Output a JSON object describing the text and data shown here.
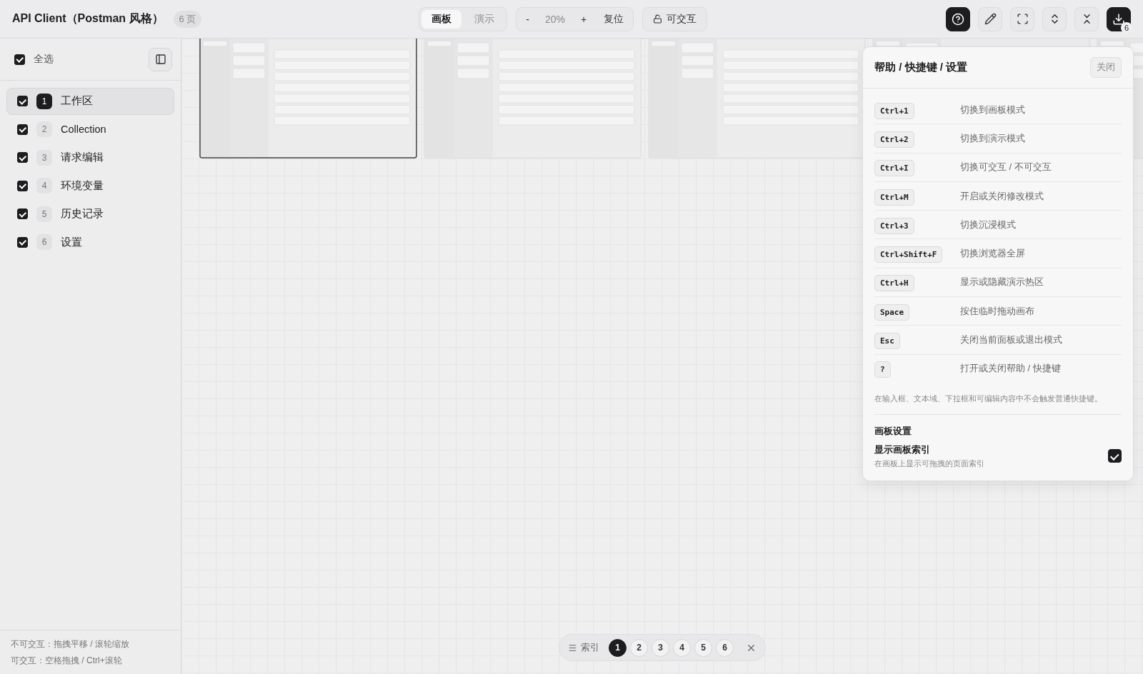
{
  "app": {
    "title": "API Client（Postman 风格）",
    "page_count": "6 页"
  },
  "mode_tabs": [
    {
      "label": "画板",
      "selected": true
    },
    {
      "label": "演示",
      "selected": false
    }
  ],
  "zoom": {
    "minus": "-",
    "value": "20%",
    "plus": "+",
    "reset": "复位"
  },
  "interact_button": {
    "label": "可交互",
    "locked": false
  },
  "toolbar": [
    {
      "kind": "help",
      "selected": true
    },
    {
      "kind": "edit",
      "selected": false
    },
    {
      "kind": "fullscreen",
      "selected": false
    },
    {
      "kind": "expand",
      "selected": false
    },
    {
      "kind": "collapse",
      "selected": false
    },
    {
      "kind": "download",
      "selected": true,
      "badge": "6"
    }
  ],
  "sidebar": {
    "select_all": {
      "label": "全选",
      "checked": true
    },
    "pages": [
      {
        "number": "1",
        "label": "工作区",
        "checked": true,
        "selected": true
      },
      {
        "number": "2",
        "label": "Collection",
        "checked": true,
        "selected": false
      },
      {
        "number": "3",
        "label": "请求编辑",
        "checked": true,
        "selected": false
      },
      {
        "number": "4",
        "label": "环境变量",
        "checked": true,
        "selected": false
      },
      {
        "number": "5",
        "label": "历史记录",
        "checked": true,
        "selected": false
      },
      {
        "number": "6",
        "label": "设置",
        "checked": true,
        "selected": false
      }
    ],
    "hints": [
      "不可交互：拖拽平移 / 滚轮缩放",
      "可交互：空格拖拽 / Ctrl+滚轮"
    ]
  },
  "canvas": {
    "thumbnails": [
      {
        "selected": true
      },
      {
        "selected": false
      },
      {
        "selected": false
      },
      {
        "selected": false
      },
      {
        "selected": false
      }
    ]
  },
  "page_index": {
    "label": "索引",
    "pages": [
      {
        "number": "1",
        "selected": true
      },
      {
        "number": "2",
        "selected": false
      },
      {
        "number": "3",
        "selected": false
      },
      {
        "number": "4",
        "selected": false
      },
      {
        "number": "5",
        "selected": false
      },
      {
        "number": "6",
        "selected": false
      }
    ]
  },
  "help_panel": {
    "title": "帮助 / 快捷键 / 设置",
    "close": "关闭",
    "shortcuts": [
      {
        "key": "Ctrl+1",
        "description": "切换到画板模式"
      },
      {
        "key": "Ctrl+2",
        "description": "切换到演示模式"
      },
      {
        "key": "Ctrl+I",
        "description": "切换可交互 / 不可交互"
      },
      {
        "key": "Ctrl+M",
        "description": "开启或关闭修改模式"
      },
      {
        "key": "Ctrl+3",
        "description": "切换沉浸模式"
      },
      {
        "key": "Ctrl+Shift+F",
        "description": "切换浏览器全屏"
      },
      {
        "key": "Ctrl+H",
        "description": "显示或隐藏演示热区"
      },
      {
        "key": "Space",
        "description": "按住临时拖动画布"
      },
      {
        "key": "Esc",
        "description": "关闭当前面板或退出模式"
      },
      {
        "key": "?",
        "description": "打开或关闭帮助 / 快捷键"
      }
    ],
    "note": "在输入框、文本域、下拉框和可编辑内容中不会触发普通快捷键。",
    "settings_title": "画板设置",
    "setting": {
      "label": "显示画板索引",
      "description": "在画板上显示可拖拽的页面索引",
      "checked": true
    }
  }
}
